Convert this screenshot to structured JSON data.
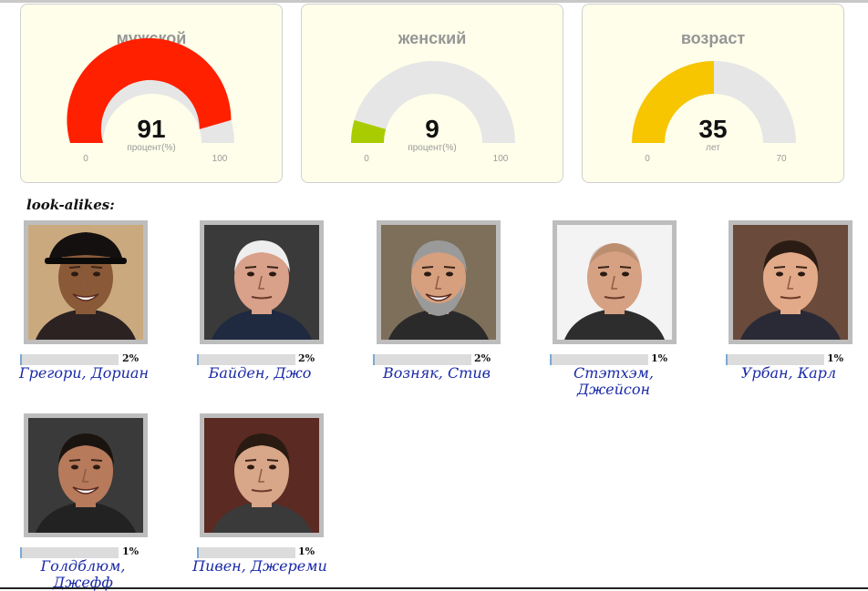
{
  "gauges": [
    {
      "title": "мужской",
      "value": "91",
      "unit": "процент(%)",
      "min": "0",
      "max": "100",
      "fraction": 0.91,
      "color": "#ff2000"
    },
    {
      "title": "женский",
      "value": "9",
      "unit": "процент(%)",
      "min": "0",
      "max": "100",
      "fraction": 0.09,
      "color": "#a8cc00"
    },
    {
      "title": "возраст",
      "value": "35",
      "unit": "лет",
      "min": "0",
      "max": "70",
      "fraction": 0.5,
      "color": "#f7c600"
    }
  ],
  "lookalikes": {
    "label": "look-alikes:",
    "people": [
      {
        "name": "Грегори, Дориан",
        "percent": "2%",
        "fraction": 0.02
      },
      {
        "name": "Байден, Джо",
        "percent": "2%",
        "fraction": 0.02
      },
      {
        "name": "Возняк, Стив",
        "percent": "2%",
        "fraction": 0.02
      },
      {
        "name": "Стэтхэм, Джейсон",
        "percent": "1%",
        "fraction": 0.01
      },
      {
        "name": "Урбан, Карл",
        "percent": "1%",
        "fraction": 0.01
      },
      {
        "name": "Голдблюм, Джефф",
        "percent": "1%",
        "fraction": 0.01
      },
      {
        "name": "Пивен, Джереми",
        "percent": "1%",
        "fraction": 0.01
      }
    ]
  }
}
